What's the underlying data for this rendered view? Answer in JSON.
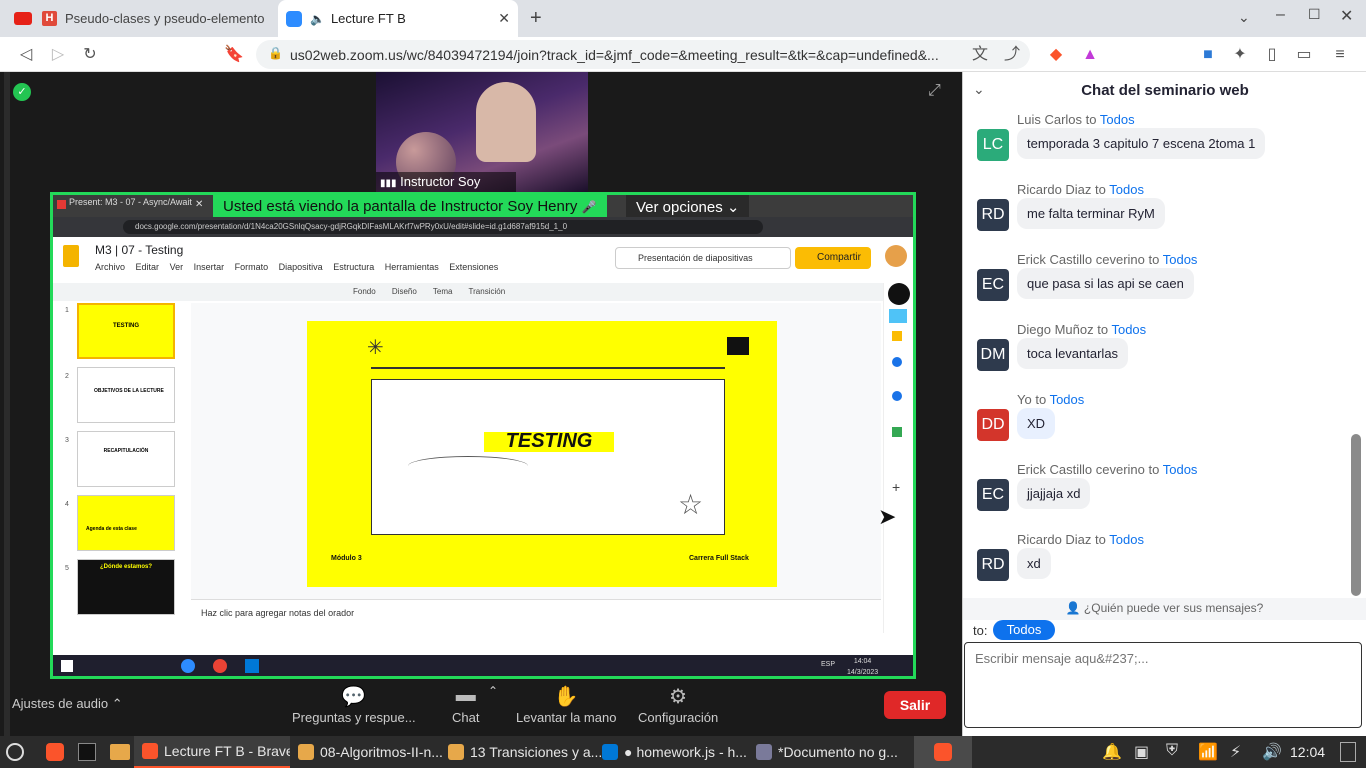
{
  "browser": {
    "tabs": [
      {
        "label": "Pseudo-clases y pseudo-elemento"
      },
      {
        "label": "Lecture FT B"
      }
    ],
    "new_tab": "+",
    "url": "us02web.zoom.us/wc/84039472194/join?track_id=&jmf_code=&meeting_result=&tk=&cap=undefined&..."
  },
  "zoom": {
    "speaker_name": "Instructor Soy Henry",
    "share_banner": "Usted está viendo la pantalla de Instructor Soy Henry",
    "view_options": "Ver opciones",
    "audio_settings": "Ajustes de audio",
    "controls": [
      {
        "label": "Preguntas y respue...",
        "icon": "qa-icon"
      },
      {
        "label": "Chat",
        "icon": "chat-icon"
      },
      {
        "label": "Levantar la mano",
        "icon": "hand-icon"
      },
      {
        "label": "Configuración",
        "icon": "gear-icon"
      }
    ],
    "leave": "Salir"
  },
  "shared": {
    "inner_tab": "Present: M3 - 07 - Async/Await",
    "inner_url": "docs.google.com/presentation/d/1N4ca20GSnlqQsacy-gdjRGqkDIFasMLAKrf7wPRy0xU/edit#slide=id.g1d687af915d_1_0",
    "doc_title": "M3 | 07 - Testing",
    "menus": [
      "Archivo",
      "Editar",
      "Ver",
      "Insertar",
      "Formato",
      "Diapositiva",
      "Estructura",
      "Herramientas",
      "Extensiones"
    ],
    "present_btn": "Presentación de diapositivas",
    "share_btn": "Compartir",
    "toolbar": [
      "Fondo",
      "Diseño",
      "Tema",
      "Transición"
    ],
    "thumbs": [
      {
        "num": "1",
        "title": "TESTING"
      },
      {
        "num": "2",
        "title": "OBJETIVOS DE LA LECTURE"
      },
      {
        "num": "3",
        "title": "RECAPITULACIÓN"
      },
      {
        "num": "4",
        "title": "Agenda de esta clase"
      },
      {
        "num": "5",
        "title": "¿Dónde estamos?"
      }
    ],
    "slide_title": "TESTING",
    "slide_left": "Módulo 3",
    "slide_right": "Carrera Full Stack",
    "notes": "Haz clic para agregar notas del orador",
    "win_time": "14:04",
    "win_date": "14/3/2023",
    "win_lang": "ESP"
  },
  "chat": {
    "title": "Chat del seminario web",
    "to_word": "to",
    "messages": [
      {
        "sender": "Luis Carlos",
        "target": "Todos",
        "initials": "LC",
        "color": "#2bab7a",
        "text": "temporada 3 capitulo 7 escena 2toma 1"
      },
      {
        "sender": "Ricardo Diaz",
        "target": "Todos",
        "initials": "RD",
        "color": "#2e3a4d",
        "text": "me falta terminar RyM"
      },
      {
        "sender": "Erick Castillo ceverino",
        "target": "Todos",
        "initials": "EC",
        "color": "#2e3a4d",
        "text": "que pasa si las api se caen"
      },
      {
        "sender": "Diego Muñoz",
        "target": "Todos",
        "initials": "DM",
        "color": "#2e3a4d",
        "text": "toca levantarlas"
      },
      {
        "sender": "Yo",
        "target": "Todos",
        "initials": "DD",
        "color": "#d3352b",
        "text": "XD"
      },
      {
        "sender": "Erick Castillo ceverino",
        "target": "Todos",
        "initials": "EC",
        "color": "#2e3a4d",
        "text": "jjajjaja xd"
      },
      {
        "sender": "Ricardo Diaz",
        "target": "Todos",
        "initials": "RD",
        "color": "#2e3a4d",
        "text": "xd"
      }
    ],
    "who_can_see": "¿Quién puede ver sus mensajes?",
    "to_label": "to:",
    "to_target": "Todos",
    "placeholder": "Escribir mensaje aqu&#237;..."
  },
  "taskbar": {
    "items": [
      {
        "label": "Lecture FT B - Brave"
      },
      {
        "label": "08-Algoritmos-II-n..."
      },
      {
        "label": "13 Transiciones y a..."
      },
      {
        "label": "homework.js - h..."
      },
      {
        "label": "*Documento no g..."
      }
    ],
    "clock": "12:04"
  },
  "colors": {
    "zoom_blue": "#0e72ed",
    "leave_red": "#e02828",
    "share_green": "#23d959",
    "slide_yellow": "#ffff00"
  }
}
